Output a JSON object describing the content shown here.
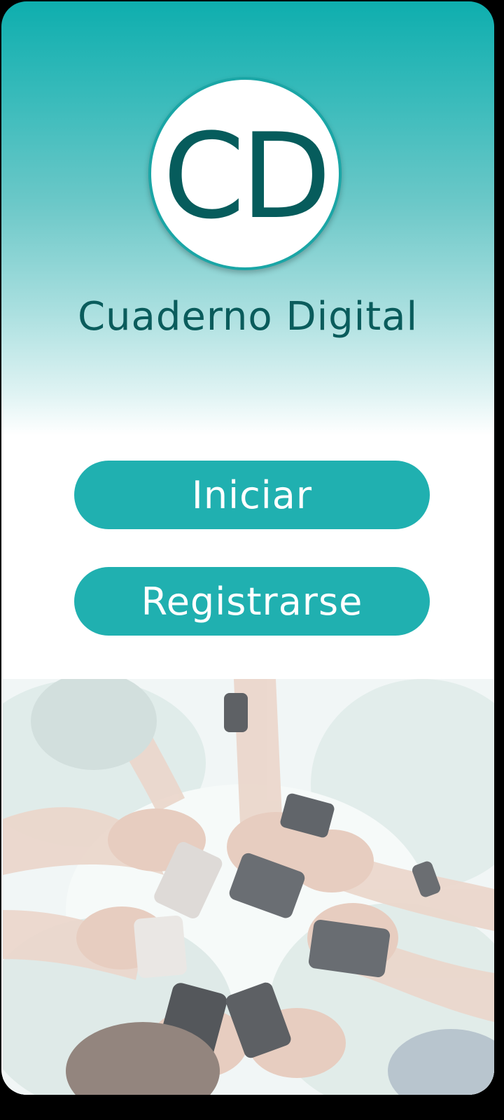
{
  "logo": {
    "initials": "CD",
    "app_name": "Cuaderno Digital"
  },
  "buttons": {
    "start_label": "Iniciar",
    "register_label": "Registrarse"
  },
  "hero_image": {
    "subject": "group-of-hands-holding-phones"
  },
  "colors": {
    "accent": "#20b0b0",
    "header_top": "#0eaeae",
    "logo_text": "#065c5c"
  }
}
